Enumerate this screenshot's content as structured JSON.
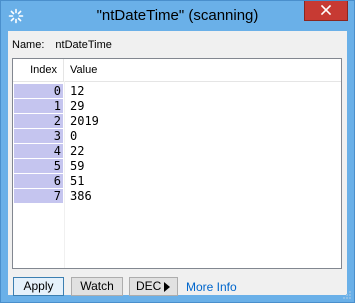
{
  "window": {
    "title": "\"ntDateTime\" (scanning)",
    "title_bar_color": "#6ab0e8",
    "close_button_color": "#c73a33"
  },
  "name_row": {
    "label": "Name:",
    "value": "ntDateTime"
  },
  "table": {
    "headers": {
      "index": "Index",
      "value": "Value"
    },
    "index_highlight_color": "#c5c5ef",
    "rows": [
      {
        "index": "0",
        "value": "12"
      },
      {
        "index": "1",
        "value": "29"
      },
      {
        "index": "2",
        "value": "2019"
      },
      {
        "index": "3",
        "value": "0"
      },
      {
        "index": "4",
        "value": "22"
      },
      {
        "index": "5",
        "value": "59"
      },
      {
        "index": "6",
        "value": "51"
      },
      {
        "index": "7",
        "value": "386"
      }
    ]
  },
  "buttons": {
    "apply": "Apply",
    "watch": "Watch",
    "dec": "DEC",
    "more_info": "More Info"
  },
  "icons": {
    "title_icon": "loading-spinner-icon",
    "close_icon": "close-icon",
    "dec_arrow": "triangle-right-icon",
    "resize_grip": "resize-grip-icon"
  }
}
